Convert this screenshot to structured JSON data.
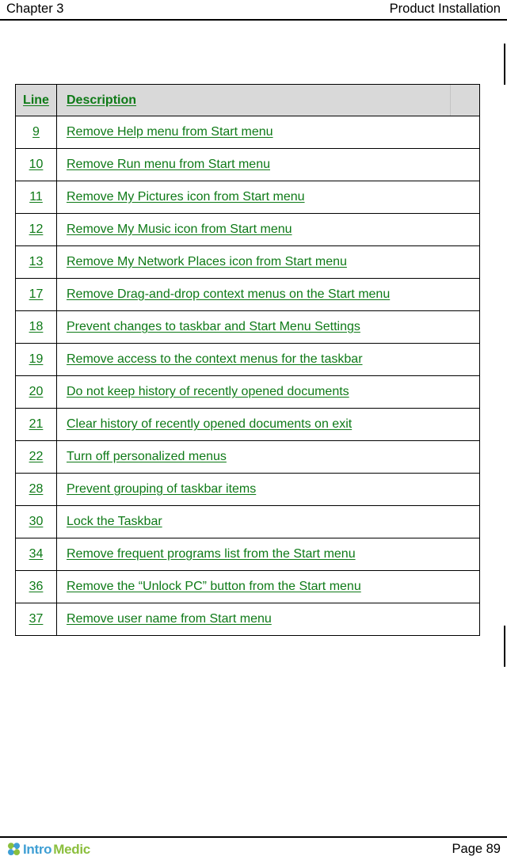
{
  "header": {
    "chapter": "Chapter 3",
    "section": "Product Installation"
  },
  "table": {
    "columns": [
      "Line",
      "Description"
    ],
    "rows": [
      {
        "line": "9",
        "description": "Remove Help menu from Start menu"
      },
      {
        "line": "10",
        "description": "Remove Run menu from Start menu"
      },
      {
        "line": "11",
        "description": "Remove My Pictures icon from Start menu"
      },
      {
        "line": "12",
        "description": "Remove My Music icon from Start menu"
      },
      {
        "line": "13",
        "description": "Remove My Network Places icon from Start menu"
      },
      {
        "line": "17",
        "description": "Remove Drag-and-drop context menus on the Start menu"
      },
      {
        "line": "18",
        "description": "Prevent changes to taskbar and Start Menu Settings"
      },
      {
        "line": "19",
        "description": "Remove access to the context menus for the taskbar"
      },
      {
        "line": "20",
        "description": "Do not keep history of recently opened documents"
      },
      {
        "line": "21",
        "description": "Clear history of recently opened documents on exit"
      },
      {
        "line": "22",
        "description": "Turn off personalized menus"
      },
      {
        "line": "28",
        "description": "Prevent grouping of taskbar items"
      },
      {
        "line": "30",
        "description": "Lock the Taskbar"
      },
      {
        "line": "34",
        "description": "Remove frequent programs list from the Start menu"
      },
      {
        "line": "36",
        "description": "Remove the “Unlock PC” button from the Start menu"
      },
      {
        "line": "37",
        "description": "Remove user name from Start menu"
      }
    ]
  },
  "footer": {
    "brand_first": "Intro",
    "brand_second": "Medic",
    "page_number": "Page 89"
  },
  "colors": {
    "link_green": "#0e7a17",
    "header_fill": "#d9d9d9",
    "brand_blue": "#3f9fd4",
    "brand_green": "#8bbf3d"
  }
}
